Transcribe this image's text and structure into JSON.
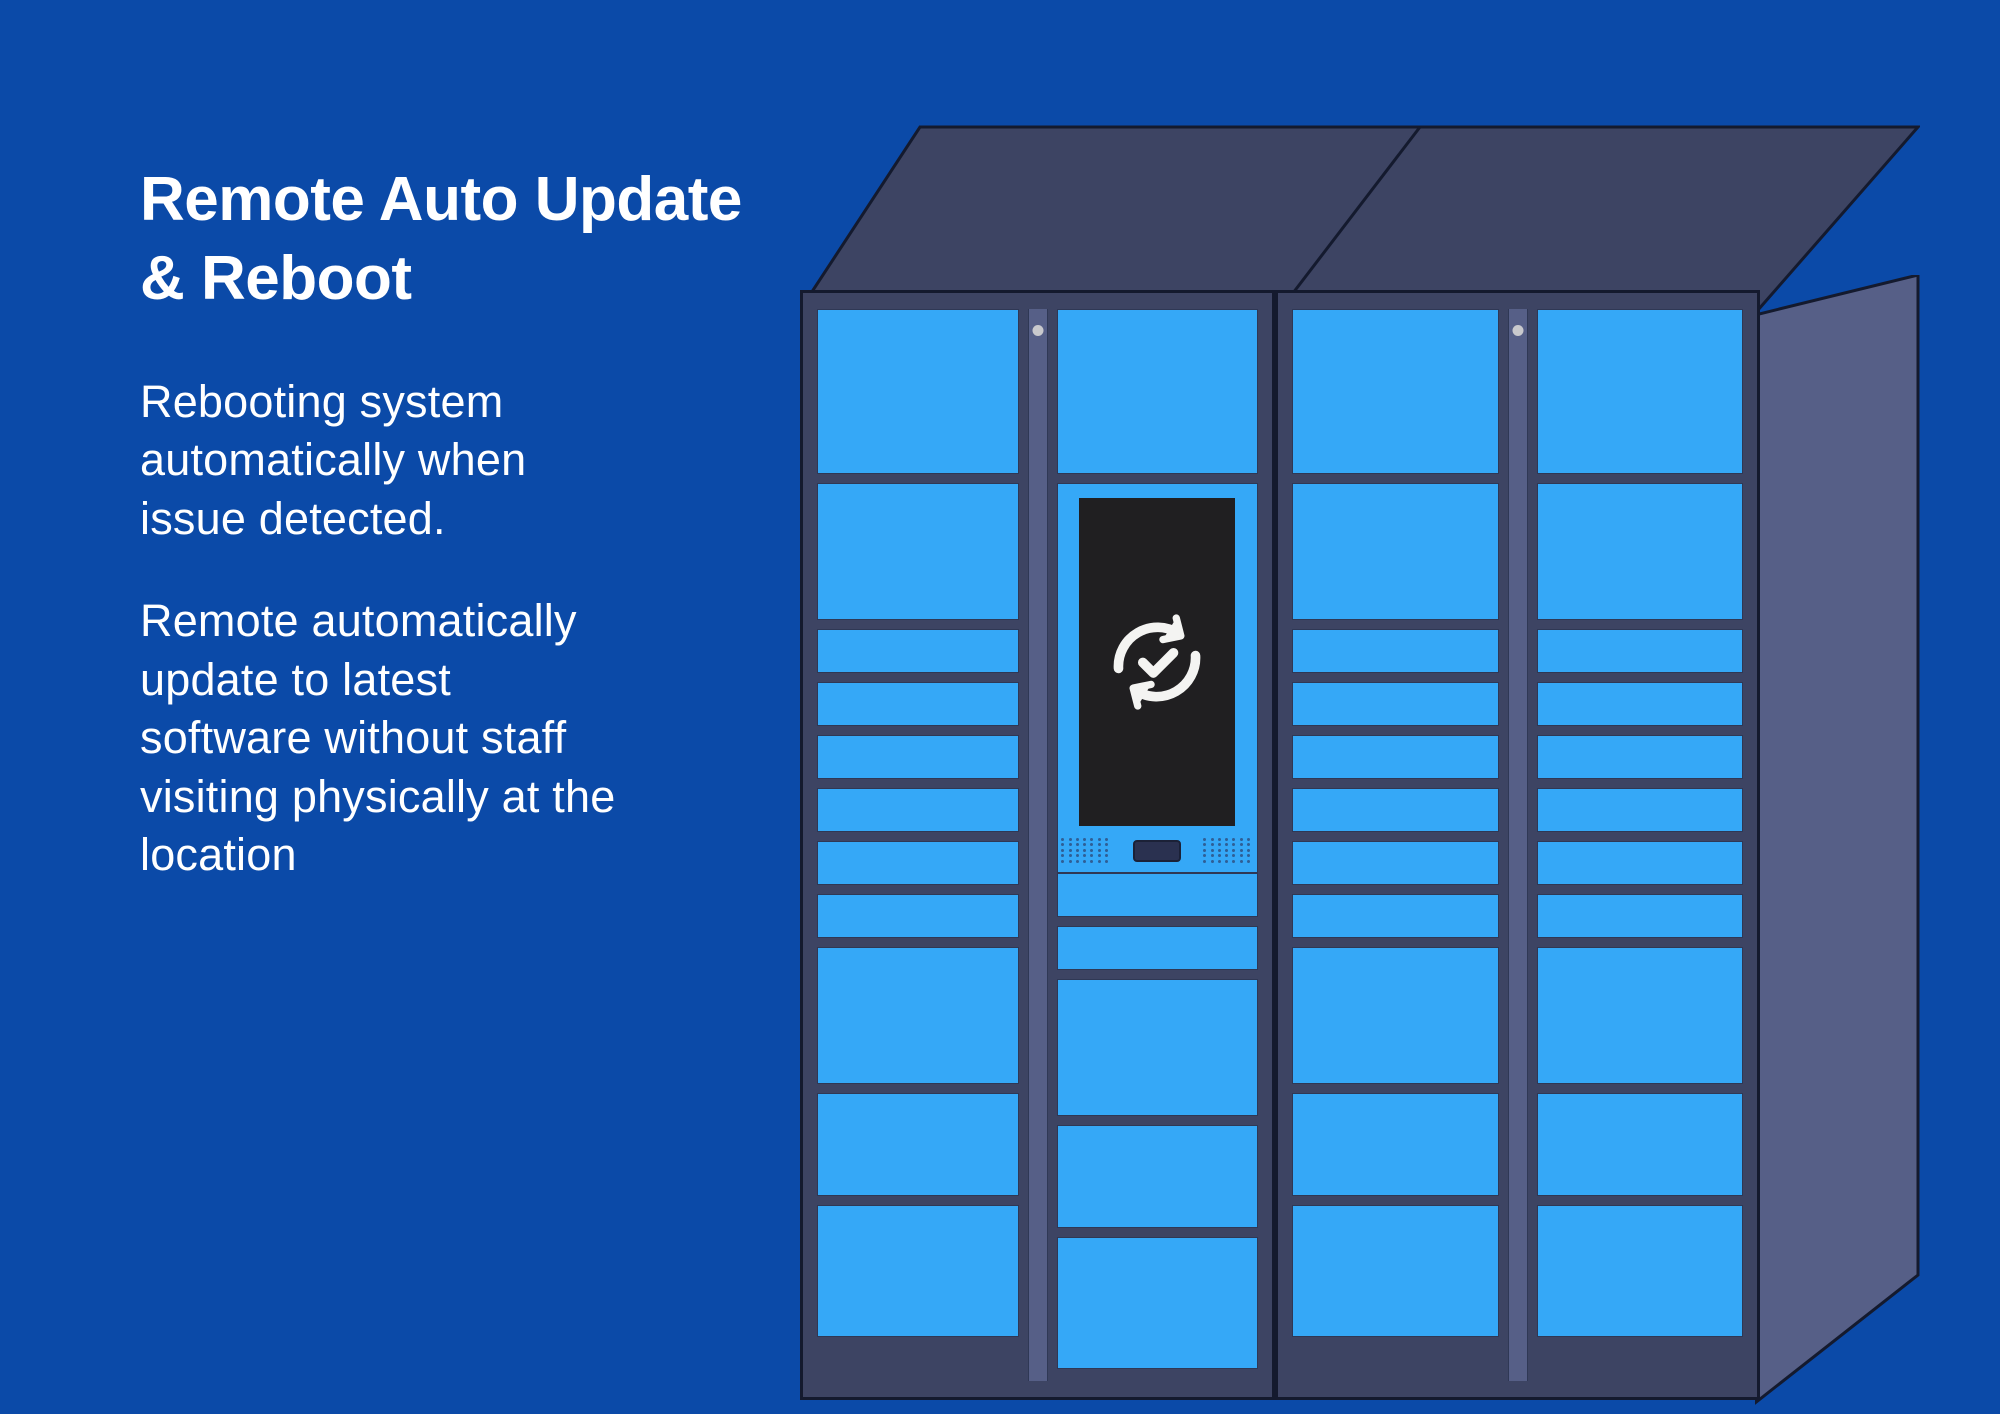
{
  "page": {
    "background_color": "#0b4aa8",
    "accent_color": "#35a8f7",
    "frame_color": "#3d4463",
    "screen_color": "#201f21",
    "text_color": "#ffffff"
  },
  "content": {
    "headline": "Remote Auto Update & Reboot",
    "paragraph_1": "Rebooting system automatically when issue detected.",
    "paragraph_2": "Remote automatically update to latest software without staff visiting physically at the location"
  },
  "illustration": {
    "name": "smart-parcel-locker",
    "kiosk": {
      "screen_icon": "sync-check-icon",
      "speaker_grille_left": "speaker-grille-icon",
      "speaker_grille_right": "speaker-grille-icon",
      "card_slot": "card-reader-slot"
    },
    "cabinets": [
      {
        "id": "cabinet-left",
        "columns": [
          {
            "id": "col-1",
            "door_heights": [
              165,
              137,
              44,
              44,
              44,
              44,
              44,
              44,
              137,
              103,
              132
            ]
          },
          {
            "id": "col-2-kiosk",
            "door_heights": [
              165,
              390,
              44,
              44,
              137,
              103,
              132
            ],
            "kiosk_index": 1
          }
        ]
      },
      {
        "id": "cabinet-right",
        "columns": [
          {
            "id": "col-3",
            "door_heights": [
              165,
              137,
              44,
              44,
              44,
              44,
              44,
              44,
              137,
              103,
              132
            ]
          },
          {
            "id": "col-4",
            "door_heights": [
              165,
              137,
              44,
              44,
              44,
              44,
              44,
              44,
              137,
              103,
              132
            ]
          }
        ]
      }
    ]
  }
}
